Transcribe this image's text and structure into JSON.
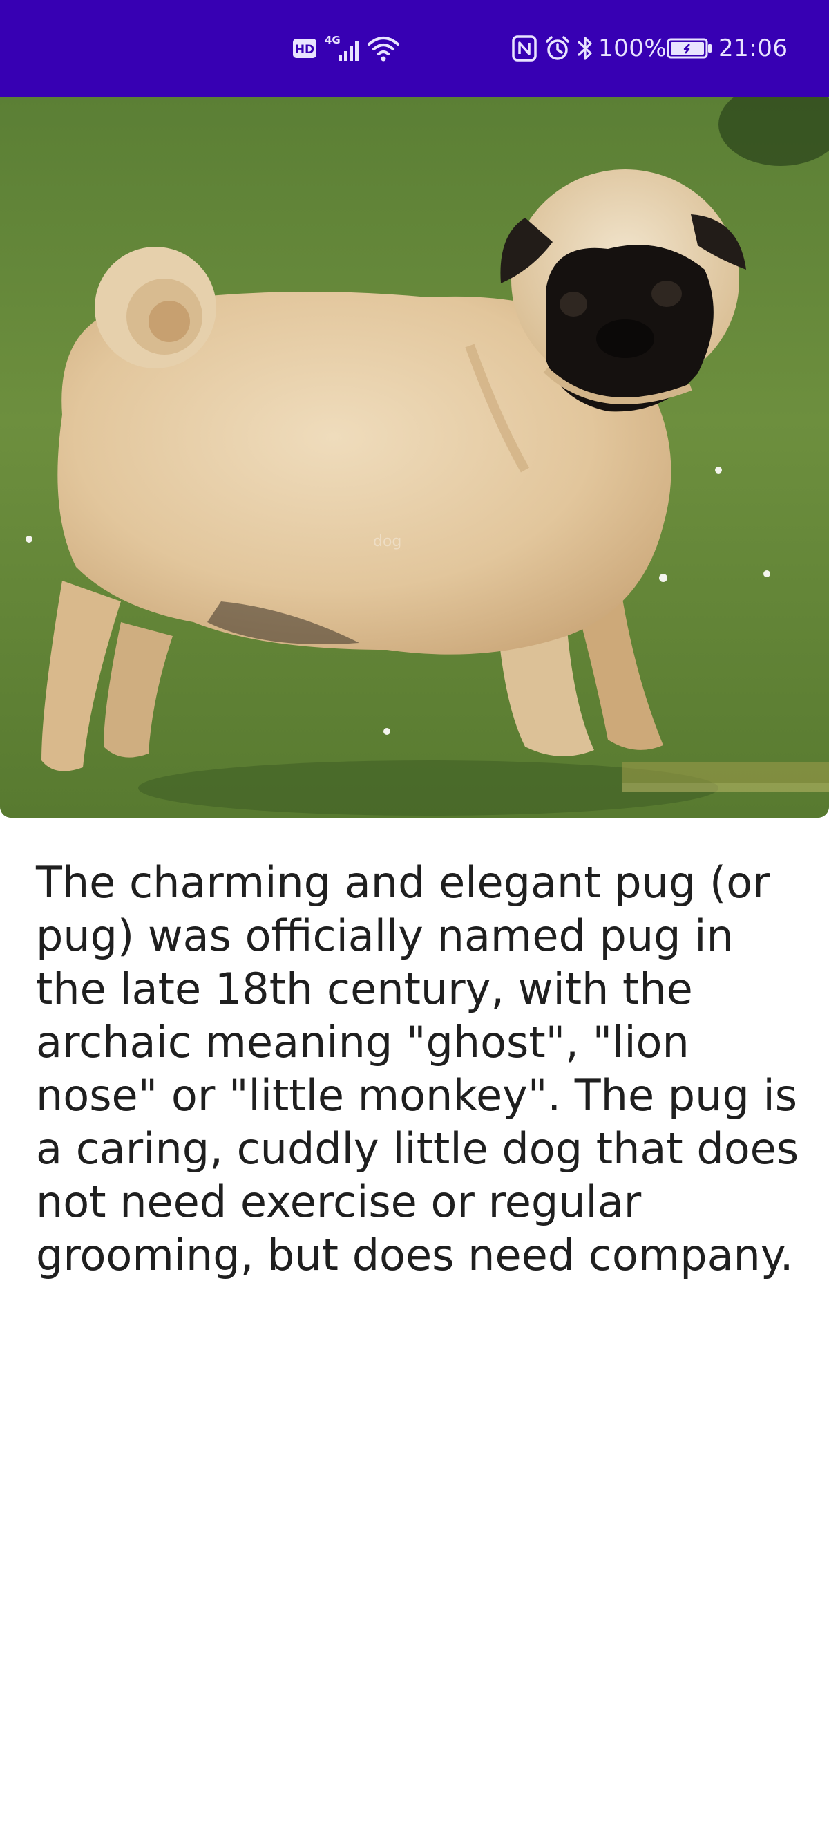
{
  "status_bar": {
    "background": "#3700b3",
    "hd_badge": "HD",
    "network_type": "4G",
    "icons": [
      "hd-icon",
      "signal-icon",
      "wifi-icon",
      "nfc-icon",
      "alarm-icon",
      "bluetooth-icon",
      "battery-icon"
    ],
    "battery_level": "100%",
    "battery_fraction": 1.0,
    "time": "21:06"
  },
  "hero_image": {
    "subject": "pug-photo"
  },
  "description": "The charming and elegant pug (or pug) was officially named pug in the late 18th century, with the archaic meaning \"ghost\", \"lion nose\" or \"little monkey\". The pug is a caring, cuddly little dog that does not need exercise or regular grooming, but does need company."
}
